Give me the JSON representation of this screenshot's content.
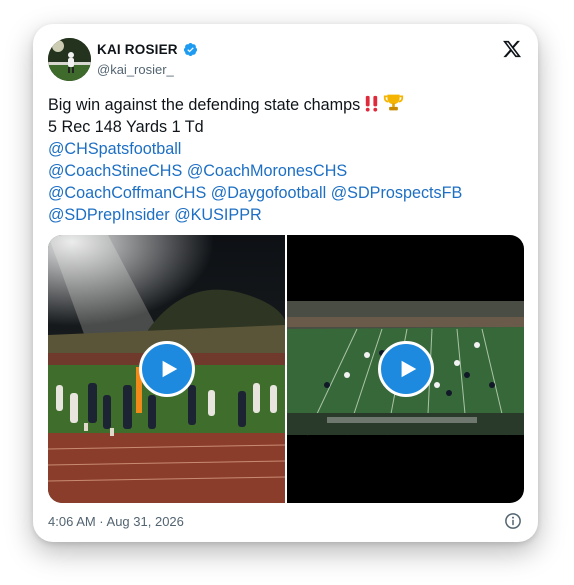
{
  "author": {
    "name": "KAI ROSIER",
    "handle": "@kai_rosier_",
    "verified": true
  },
  "tweet": {
    "text_line1": "Big win against the defending state champs",
    "text_line2": "5 Rec 148 Yards 1 Td",
    "emoji_1": "double-exclamation-mark",
    "emoji_2": "trophy",
    "mentions": [
      "@CHSpatsfootball",
      "@CoachStineCHS",
      "@CoachMoronesCHS",
      "@CoachCoffmanCHS",
      "@Daygofootball",
      "@SDProspectsFB",
      "@SDPrepInsider",
      "@KUSIPPR"
    ]
  },
  "media": [
    {
      "type": "video",
      "scene": "sideline-celebration-night"
    },
    {
      "type": "video",
      "scene": "broadcast-field-night"
    }
  ],
  "meta": {
    "timestamp": "4:06 AM · Aug 31, 2026"
  },
  "icons": {
    "platform": "x-logo-icon",
    "info": "info-icon",
    "play": "play-icon"
  },
  "colors": {
    "mention": "#1d6fc4",
    "verified": "#1d9bf0",
    "play_button": "#1d8ae0",
    "text": "#0f1419",
    "secondary_text": "#536471"
  }
}
